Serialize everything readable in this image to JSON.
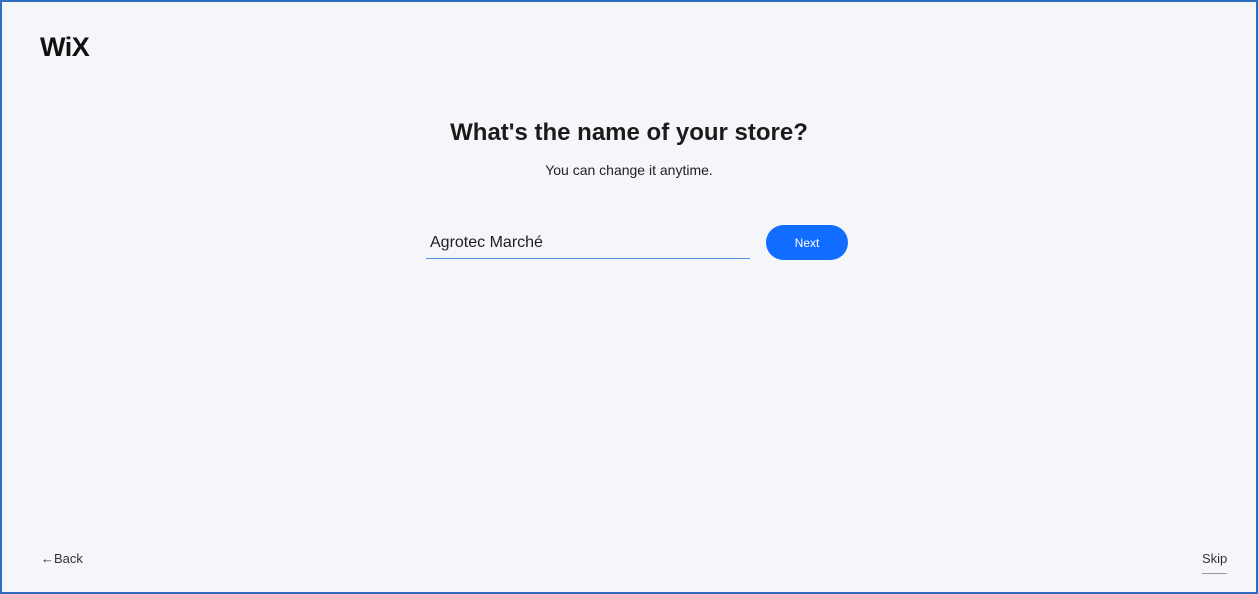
{
  "header": {
    "logo_text": "WiX"
  },
  "main": {
    "title": "What's the name of your store?",
    "subtitle": "You can change it anytime.",
    "store_name_input": {
      "value": "Agrotec Marché"
    },
    "next_label": "Next"
  },
  "footer": {
    "back_label": "←Back",
    "skip_label": "Skip"
  },
  "colors": {
    "accent": "#116DFF",
    "input_underline": "#4D8FE0",
    "background": "#F4F6F9",
    "window_border": "#2F6FBF"
  }
}
